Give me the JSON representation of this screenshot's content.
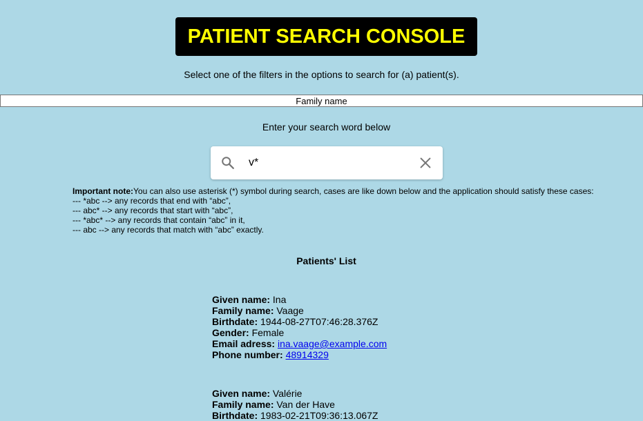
{
  "header": {
    "title": "PATIENT SEARCH CONSOLE",
    "subtitle": "Select one of the filters in the options to search for (a) patient(s)."
  },
  "filter": {
    "selected": "Family name"
  },
  "search": {
    "label": "Enter your search word below",
    "value": "v*"
  },
  "note": {
    "heading": "Important note:",
    "intro": "You can also use asterisk (*) symbol during search, cases are like down below and the application should satisfy these cases:",
    "lines": [
      "--- *abc --> any records that end with “abc”,",
      "--- abc* --> any records that start with “abc”,",
      "--- *abc* --> any records that contain “abc” in it,",
      "--- abc --> any records that match with “abc” exactly."
    ]
  },
  "list": {
    "title": "Patients' List",
    "labels": {
      "given": "Given name:",
      "family": "Family name:",
      "birthdate": "Birthdate:",
      "gender": "Gender:",
      "email": "Email adress:",
      "phone": "Phone number:"
    },
    "patients": [
      {
        "given": "Ina",
        "family": "Vaage",
        "birthdate": "1944-08-27T07:46:28.376Z",
        "gender": "Female",
        "email": "ina.vaage@example.com",
        "phone": "48914329"
      },
      {
        "given": "Valérie",
        "family": "Van der Have",
        "birthdate": "1983-02-21T09:36:13.067Z"
      }
    ]
  }
}
